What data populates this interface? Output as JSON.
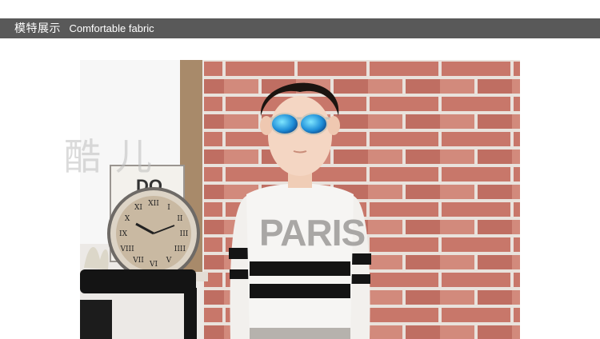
{
  "header": {
    "title_cn": "模特展示",
    "title_en": "Comfortable fabric"
  },
  "photo": {
    "shirt_text": "PARIS",
    "sign_text": "DO",
    "clock_numerals": [
      "XII",
      "I",
      "II",
      "III",
      "IIII",
      "V",
      "VI",
      "VII",
      "VIII",
      "IX",
      "X",
      "XI"
    ]
  },
  "watermark": "酷儿"
}
